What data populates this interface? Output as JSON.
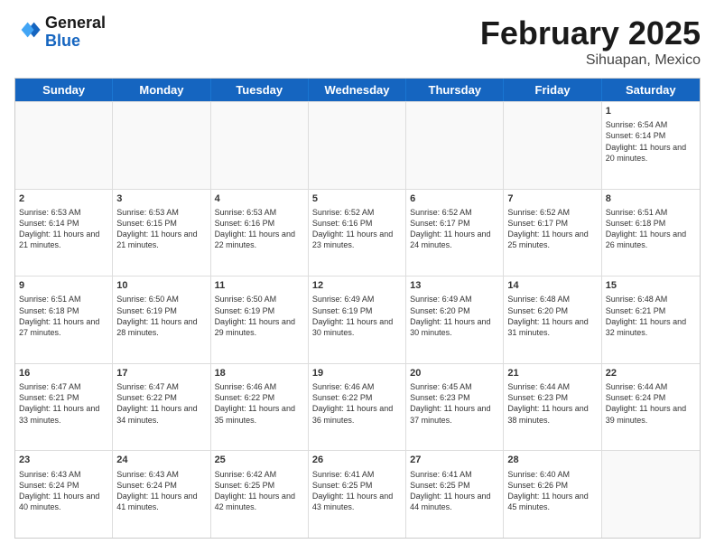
{
  "logo": {
    "line1": "General",
    "line2": "Blue"
  },
  "title": {
    "month_year": "February 2025",
    "location": "Sihuapan, Mexico"
  },
  "weekdays": [
    "Sunday",
    "Monday",
    "Tuesday",
    "Wednesday",
    "Thursday",
    "Friday",
    "Saturday"
  ],
  "weeks": [
    [
      {
        "day": "",
        "info": ""
      },
      {
        "day": "",
        "info": ""
      },
      {
        "day": "",
        "info": ""
      },
      {
        "day": "",
        "info": ""
      },
      {
        "day": "",
        "info": ""
      },
      {
        "day": "",
        "info": ""
      },
      {
        "day": "1",
        "info": "Sunrise: 6:54 AM\nSunset: 6:14 PM\nDaylight: 11 hours and 20 minutes."
      }
    ],
    [
      {
        "day": "2",
        "info": "Sunrise: 6:53 AM\nSunset: 6:14 PM\nDaylight: 11 hours and 21 minutes."
      },
      {
        "day": "3",
        "info": "Sunrise: 6:53 AM\nSunset: 6:15 PM\nDaylight: 11 hours and 21 minutes."
      },
      {
        "day": "4",
        "info": "Sunrise: 6:53 AM\nSunset: 6:16 PM\nDaylight: 11 hours and 22 minutes."
      },
      {
        "day": "5",
        "info": "Sunrise: 6:52 AM\nSunset: 6:16 PM\nDaylight: 11 hours and 23 minutes."
      },
      {
        "day": "6",
        "info": "Sunrise: 6:52 AM\nSunset: 6:17 PM\nDaylight: 11 hours and 24 minutes."
      },
      {
        "day": "7",
        "info": "Sunrise: 6:52 AM\nSunset: 6:17 PM\nDaylight: 11 hours and 25 minutes."
      },
      {
        "day": "8",
        "info": "Sunrise: 6:51 AM\nSunset: 6:18 PM\nDaylight: 11 hours and 26 minutes."
      }
    ],
    [
      {
        "day": "9",
        "info": "Sunrise: 6:51 AM\nSunset: 6:18 PM\nDaylight: 11 hours and 27 minutes."
      },
      {
        "day": "10",
        "info": "Sunrise: 6:50 AM\nSunset: 6:19 PM\nDaylight: 11 hours and 28 minutes."
      },
      {
        "day": "11",
        "info": "Sunrise: 6:50 AM\nSunset: 6:19 PM\nDaylight: 11 hours and 29 minutes."
      },
      {
        "day": "12",
        "info": "Sunrise: 6:49 AM\nSunset: 6:19 PM\nDaylight: 11 hours and 30 minutes."
      },
      {
        "day": "13",
        "info": "Sunrise: 6:49 AM\nSunset: 6:20 PM\nDaylight: 11 hours and 30 minutes."
      },
      {
        "day": "14",
        "info": "Sunrise: 6:48 AM\nSunset: 6:20 PM\nDaylight: 11 hours and 31 minutes."
      },
      {
        "day": "15",
        "info": "Sunrise: 6:48 AM\nSunset: 6:21 PM\nDaylight: 11 hours and 32 minutes."
      }
    ],
    [
      {
        "day": "16",
        "info": "Sunrise: 6:47 AM\nSunset: 6:21 PM\nDaylight: 11 hours and 33 minutes."
      },
      {
        "day": "17",
        "info": "Sunrise: 6:47 AM\nSunset: 6:22 PM\nDaylight: 11 hours and 34 minutes."
      },
      {
        "day": "18",
        "info": "Sunrise: 6:46 AM\nSunset: 6:22 PM\nDaylight: 11 hours and 35 minutes."
      },
      {
        "day": "19",
        "info": "Sunrise: 6:46 AM\nSunset: 6:22 PM\nDaylight: 11 hours and 36 minutes."
      },
      {
        "day": "20",
        "info": "Sunrise: 6:45 AM\nSunset: 6:23 PM\nDaylight: 11 hours and 37 minutes."
      },
      {
        "day": "21",
        "info": "Sunrise: 6:44 AM\nSunset: 6:23 PM\nDaylight: 11 hours and 38 minutes."
      },
      {
        "day": "22",
        "info": "Sunrise: 6:44 AM\nSunset: 6:24 PM\nDaylight: 11 hours and 39 minutes."
      }
    ],
    [
      {
        "day": "23",
        "info": "Sunrise: 6:43 AM\nSunset: 6:24 PM\nDaylight: 11 hours and 40 minutes."
      },
      {
        "day": "24",
        "info": "Sunrise: 6:43 AM\nSunset: 6:24 PM\nDaylight: 11 hours and 41 minutes."
      },
      {
        "day": "25",
        "info": "Sunrise: 6:42 AM\nSunset: 6:25 PM\nDaylight: 11 hours and 42 minutes."
      },
      {
        "day": "26",
        "info": "Sunrise: 6:41 AM\nSunset: 6:25 PM\nDaylight: 11 hours and 43 minutes."
      },
      {
        "day": "27",
        "info": "Sunrise: 6:41 AM\nSunset: 6:25 PM\nDaylight: 11 hours and 44 minutes."
      },
      {
        "day": "28",
        "info": "Sunrise: 6:40 AM\nSunset: 6:26 PM\nDaylight: 11 hours and 45 minutes."
      },
      {
        "day": "",
        "info": ""
      }
    ]
  ]
}
